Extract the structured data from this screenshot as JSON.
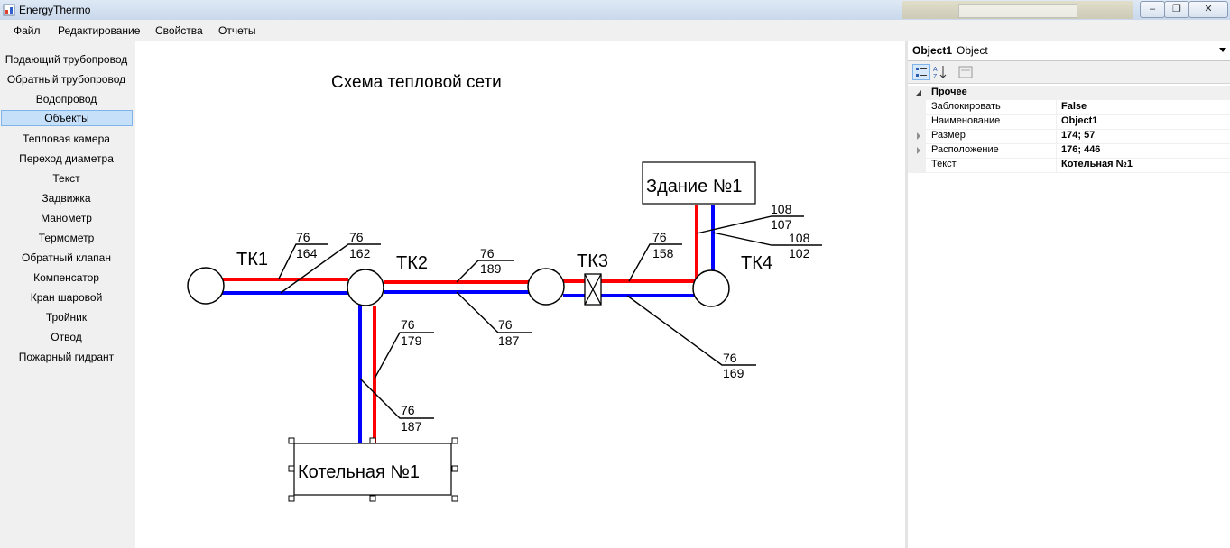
{
  "window": {
    "title": "EnergyThermo"
  },
  "menu": [
    "Файл",
    "Редактирование",
    "Свойства",
    "Отчеты"
  ],
  "toolbox": {
    "items": [
      "Подающий трубопровод",
      "Обратный трубопровод",
      "Водопровод",
      "Объекты",
      "Тепловая камера",
      "Переход диаметра",
      "Текст",
      "Задвижка",
      "Манометр",
      "Термометр",
      "Обратный клапан",
      "Компенсатор",
      "Кран шаровой",
      "Тройник",
      "Отвод",
      "Пожарный гидрант"
    ],
    "selected_index": 3
  },
  "diagram": {
    "title": "Схема тепловой сети",
    "chambers": [
      "ТК1",
      "ТК2",
      "ТК3",
      "ТК4"
    ],
    "building": "Здание №1",
    "boiler": "Котельная №1",
    "labels": [
      {
        "top": "76",
        "bottom": "164"
      },
      {
        "top": "76",
        "bottom": "162"
      },
      {
        "top": "76",
        "bottom": "189"
      },
      {
        "top": "76",
        "bottom": "187"
      },
      {
        "top": "76",
        "bottom": "158"
      },
      {
        "top": "108",
        "bottom": "107"
      },
      {
        "top": "108",
        "bottom": "102"
      },
      {
        "top": "76",
        "bottom": "169"
      },
      {
        "top": "76",
        "bottom": "179"
      },
      {
        "top": "76",
        "bottom": "187"
      }
    ],
    "colors": {
      "supply": "#ff0000",
      "return": "#0000ff"
    }
  },
  "properties": {
    "object_name": "Object1",
    "object_type": "Object",
    "category": "Прочее",
    "rows": [
      {
        "name": "Заблокировать",
        "value": "False"
      },
      {
        "name": "Наименование",
        "value": "Object1"
      },
      {
        "name": "Размер",
        "value": "174; 57"
      },
      {
        "name": "Расположение",
        "value": "176; 446"
      },
      {
        "name": "Текст",
        "value": "Котельная №1"
      }
    ]
  }
}
